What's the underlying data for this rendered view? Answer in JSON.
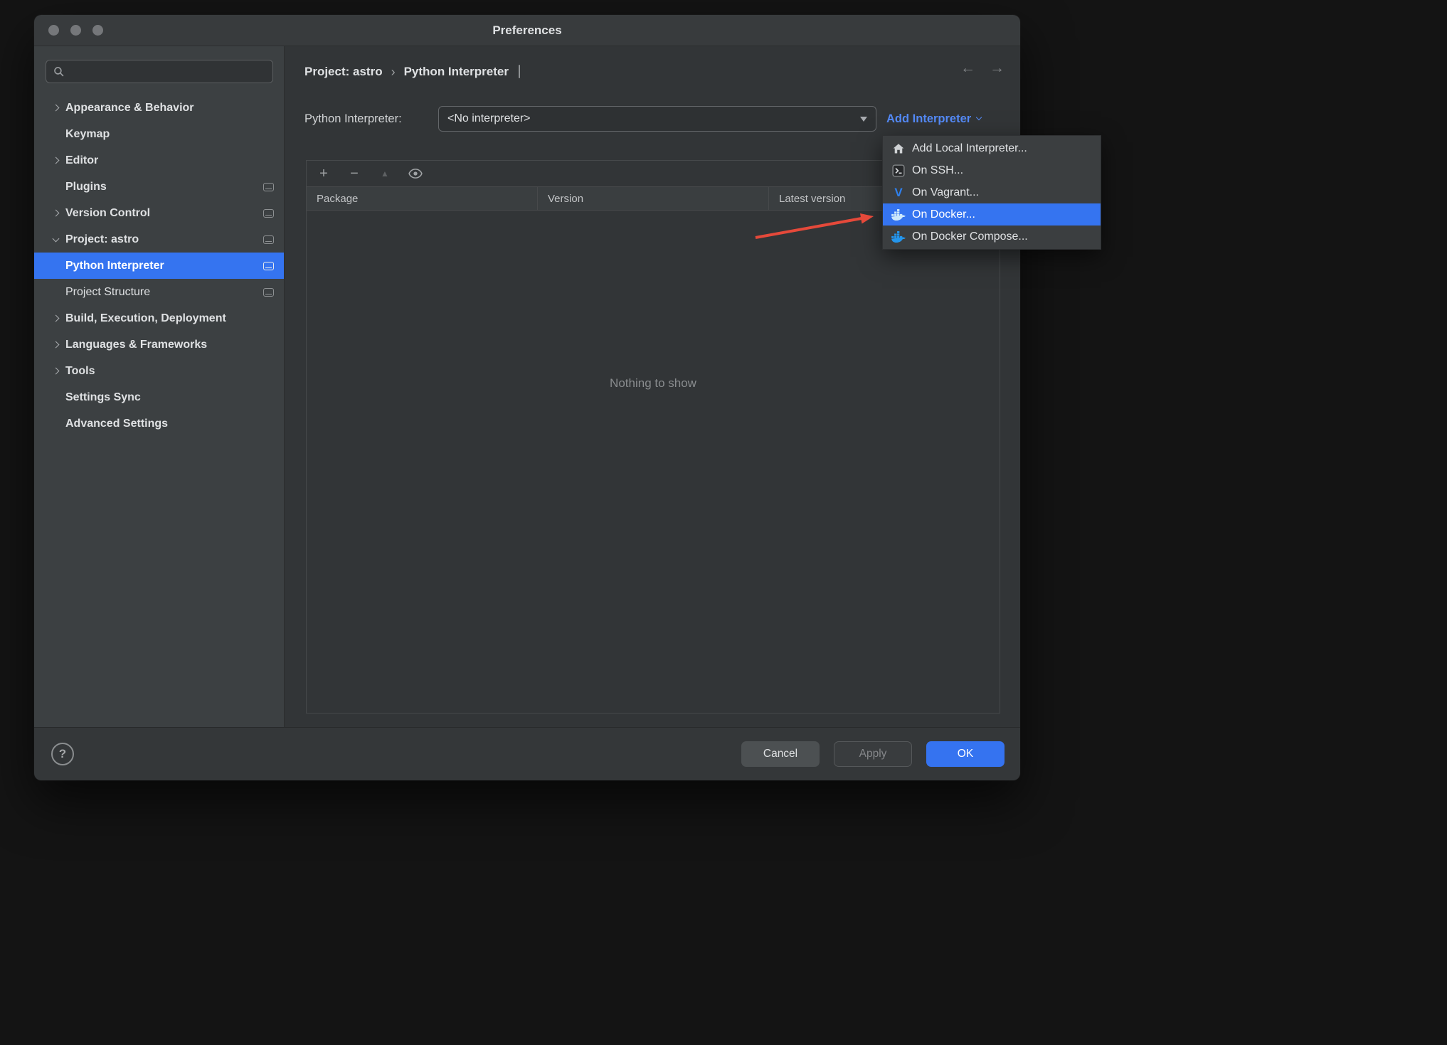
{
  "colors": {
    "accent_blue": "#3574F0",
    "link_blue": "#548AF7",
    "docker_blue": "#2496ED",
    "vagrant_blue": "#2F80ED",
    "annotation_arrow_red": "#E5493A"
  },
  "window": {
    "title": "Preferences"
  },
  "sidebar": {
    "search": {
      "value": "",
      "placeholder": ""
    },
    "selected_item": "Python Interpreter",
    "items": [
      {
        "label": "Appearance & Behavior"
      },
      {
        "label": "Keymap"
      },
      {
        "label": "Editor"
      },
      {
        "label": "Plugins"
      },
      {
        "label": "Version Control"
      },
      {
        "label": "Project: astro"
      },
      {
        "label": "Python Interpreter"
      },
      {
        "label": "Project Structure"
      },
      {
        "label": "Build, Execution, Deployment"
      },
      {
        "label": "Languages & Frameworks"
      },
      {
        "label": "Tools"
      },
      {
        "label": "Settings Sync"
      },
      {
        "label": "Advanced Settings"
      }
    ]
  },
  "header": {
    "breadcrumb": {
      "project": "Project: astro",
      "separator": "›",
      "page": "Python Interpreter"
    },
    "nav": {
      "back": "←",
      "forward": "→"
    }
  },
  "interpreter": {
    "label": "Python Interpreter:",
    "value": "<No interpreter>",
    "add_button": "Add Interpreter"
  },
  "add_interpreter_menu": {
    "items": [
      {
        "label": "Add Local Interpreter...",
        "icon": "home-icon"
      },
      {
        "label": "On SSH...",
        "icon": "ssh-icon"
      },
      {
        "label": "On Vagrant...",
        "icon": "vagrant-icon"
      },
      {
        "label": "On Docker...",
        "icon": "docker-icon",
        "selected": true
      },
      {
        "label": "On Docker Compose...",
        "icon": "docker-compose-icon"
      }
    ],
    "vagrant_letter": "V"
  },
  "packages_panel": {
    "toolbar": {
      "add": "+",
      "remove": "−",
      "up": "▲"
    },
    "columns": [
      "Package",
      "Version",
      "Latest version"
    ],
    "empty_text": "Nothing to show"
  },
  "footer": {
    "help": "?",
    "cancel": "Cancel",
    "apply": "Apply",
    "ok": "OK"
  }
}
